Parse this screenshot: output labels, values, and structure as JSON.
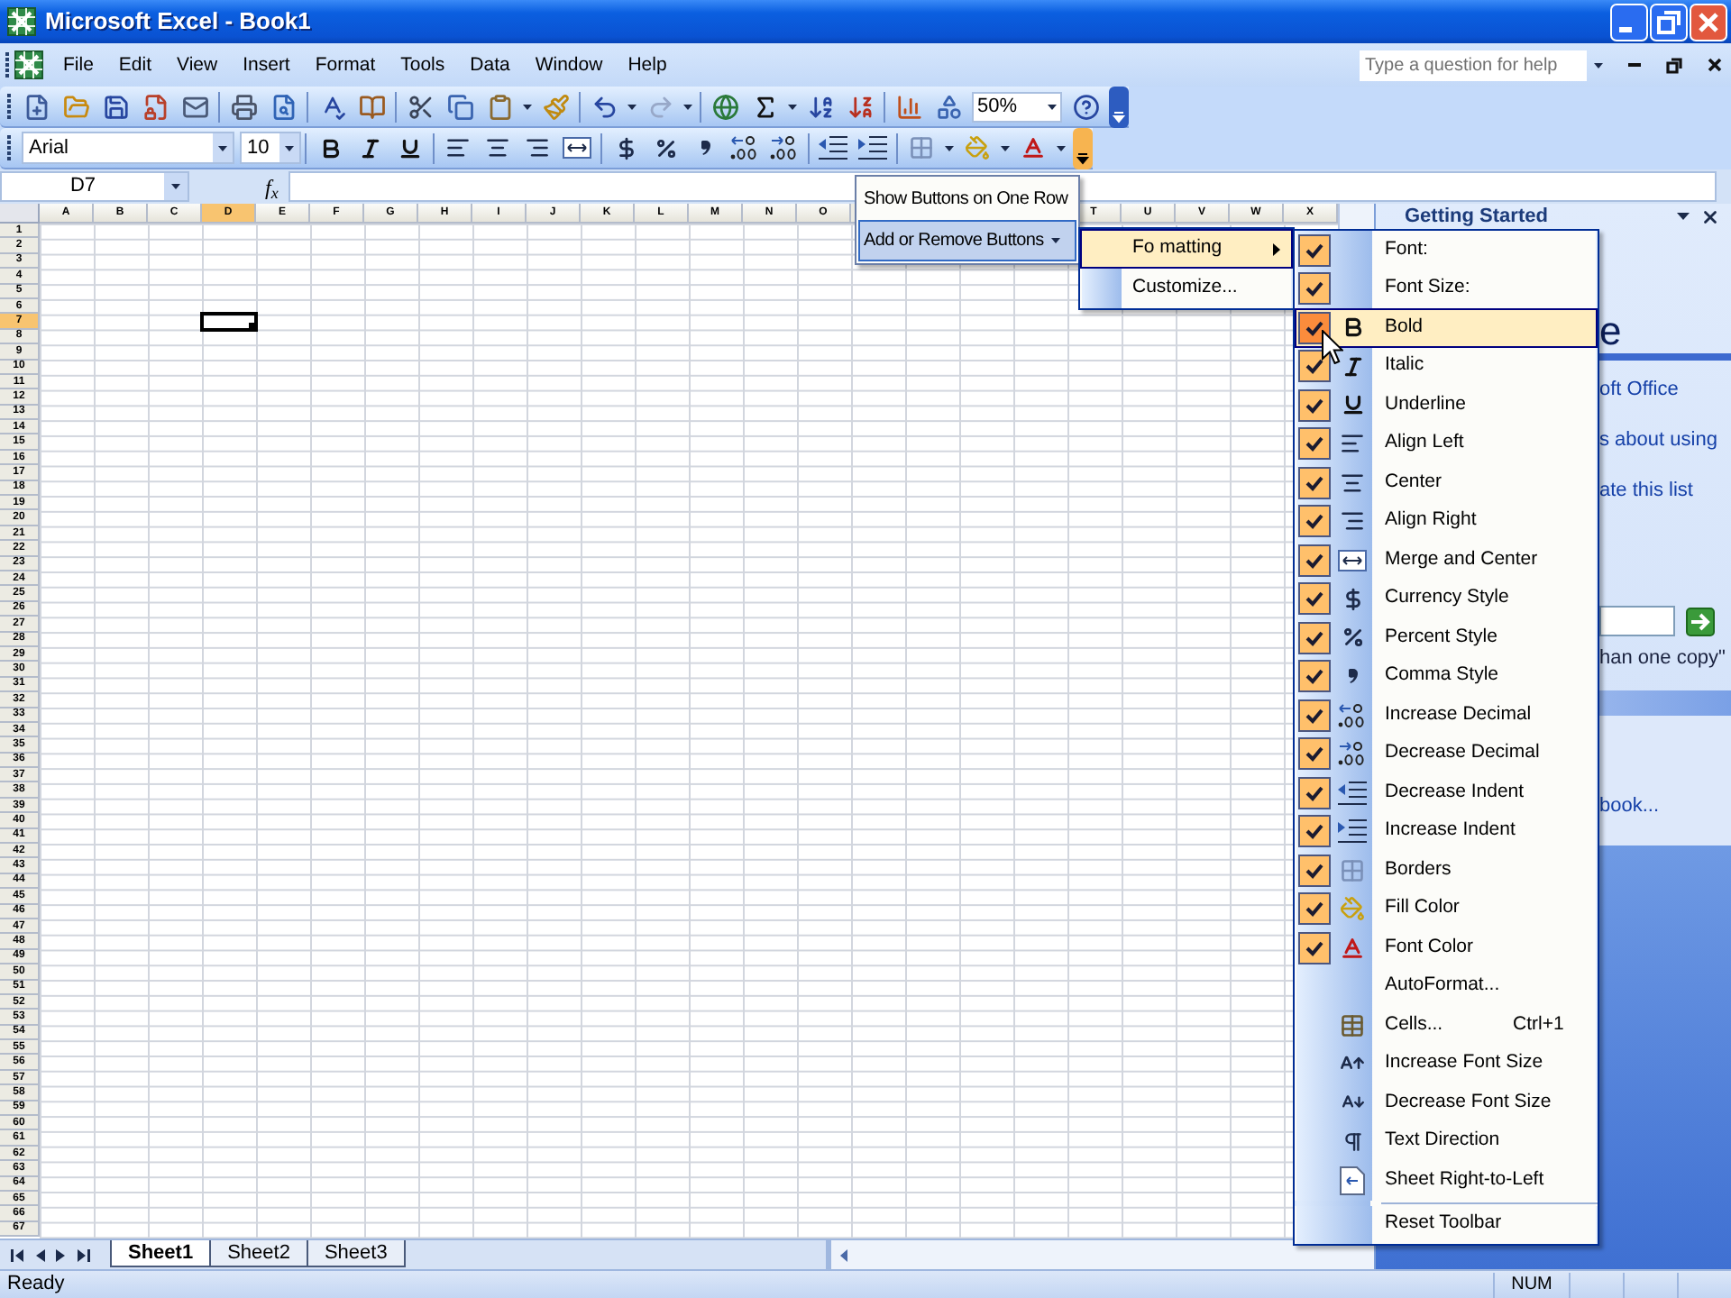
{
  "window": {
    "title": "Microsoft Excel - Book1"
  },
  "menu_bar": {
    "items": [
      "File",
      "Edit",
      "View",
      "Insert",
      "Format",
      "Tools",
      "Data",
      "Window",
      "Help"
    ],
    "help_box": {
      "placeholder": "Type a question for help"
    }
  },
  "standard_toolbar": {
    "zoom": "50%",
    "options_active": false
  },
  "formatting_toolbar": {
    "font": "Arial",
    "font_size": "10",
    "options_active": true
  },
  "formula_bar": {
    "name_box": "D7",
    "function_button": "f$_{x}$"
  },
  "grid": {
    "columns": [
      {
        "label": "A",
        "selected": false
      },
      {
        "label": "B",
        "selected": false
      },
      {
        "label": "C",
        "selected": false
      },
      {
        "label": "D",
        "selected": true
      },
      {
        "label": "E",
        "selected": false
      },
      {
        "label": "F",
        "selected": false
      },
      {
        "label": "G",
        "selected": false
      },
      {
        "label": "H",
        "selected": false
      },
      {
        "label": "I",
        "selected": false
      },
      {
        "label": "J",
        "selected": false
      },
      {
        "label": "K",
        "selected": false
      },
      {
        "label": "L",
        "selected": false
      },
      {
        "label": "M",
        "selected": false
      },
      {
        "label": "N",
        "selected": false
      },
      {
        "label": "O",
        "selected": false
      },
      {
        "label": "T",
        "selected": false
      },
      {
        "label": "U",
        "selected": false
      },
      {
        "label": "V",
        "selected": false
      },
      {
        "label": "W",
        "selected": false
      },
      {
        "label": "X",
        "selected": false
      }
    ],
    "rows": [
      {
        "label": "1",
        "selected": false
      },
      {
        "label": "2",
        "selected": false
      },
      {
        "label": "3",
        "selected": false
      },
      {
        "label": "4",
        "selected": false
      },
      {
        "label": "5",
        "selected": false
      },
      {
        "label": "6",
        "selected": false
      },
      {
        "label": "7",
        "selected": true
      },
      {
        "label": "8",
        "selected": false
      },
      {
        "label": "9",
        "selected": false
      },
      {
        "label": "10",
        "selected": false
      },
      {
        "label": "11",
        "selected": false
      },
      {
        "label": "12",
        "selected": false
      },
      {
        "label": "13",
        "selected": false
      },
      {
        "label": "14",
        "selected": false
      },
      {
        "label": "15",
        "selected": false
      },
      {
        "label": "16",
        "selected": false
      },
      {
        "label": "17",
        "selected": false
      },
      {
        "label": "18",
        "selected": false
      },
      {
        "label": "19",
        "selected": false
      },
      {
        "label": "20",
        "selected": false
      },
      {
        "label": "21",
        "selected": false
      },
      {
        "label": "22",
        "selected": false
      },
      {
        "label": "23",
        "selected": false
      },
      {
        "label": "24",
        "selected": false
      },
      {
        "label": "25",
        "selected": false
      },
      {
        "label": "26",
        "selected": false
      },
      {
        "label": "27",
        "selected": false
      },
      {
        "label": "28",
        "selected": false
      },
      {
        "label": "29",
        "selected": false
      },
      {
        "label": "30",
        "selected": false
      },
      {
        "label": "31",
        "selected": false
      },
      {
        "label": "32",
        "selected": false
      },
      {
        "label": "33",
        "selected": false
      },
      {
        "label": "34",
        "selected": false
      },
      {
        "label": "35",
        "selected": false
      },
      {
        "label": "36",
        "selected": false
      },
      {
        "label": "37",
        "selected": false
      },
      {
        "label": "38",
        "selected": false
      },
      {
        "label": "39",
        "selected": false
      },
      {
        "label": "40",
        "selected": false
      },
      {
        "label": "41",
        "selected": false
      },
      {
        "label": "42",
        "selected": false
      },
      {
        "label": "43",
        "selected": false
      },
      {
        "label": "44",
        "selected": false
      },
      {
        "label": "45",
        "selected": false
      },
      {
        "label": "46",
        "selected": false
      },
      {
        "label": "47",
        "selected": false
      },
      {
        "label": "48",
        "selected": false
      },
      {
        "label": "49",
        "selected": false
      },
      {
        "label": "50",
        "selected": false
      },
      {
        "label": "51",
        "selected": false
      },
      {
        "label": "52",
        "selected": false
      },
      {
        "label": "53",
        "selected": false
      },
      {
        "label": "54",
        "selected": false
      },
      {
        "label": "55",
        "selected": false
      },
      {
        "label": "56",
        "selected": false
      },
      {
        "label": "57",
        "selected": false
      },
      {
        "label": "58",
        "selected": false
      },
      {
        "label": "59",
        "selected": false
      },
      {
        "label": "60",
        "selected": false
      },
      {
        "label": "61",
        "selected": false
      },
      {
        "label": "62",
        "selected": false
      },
      {
        "label": "63",
        "selected": false
      },
      {
        "label": "64",
        "selected": false
      },
      {
        "label": "65",
        "selected": false
      },
      {
        "label": "66",
        "selected": false
      },
      {
        "label": "67",
        "selected": false
      }
    ]
  },
  "task_pane": {
    "title": "Getting Started",
    "heading": "e",
    "links": [
      "oft Office",
      "s about using",
      "ate this list"
    ],
    "example": "han one copy\"",
    "section_links": [
      "book..."
    ]
  },
  "toolbar_options_menu": {
    "items": [
      {
        "label": "Show Buttons on One Row",
        "selected": false,
        "submenu": false
      },
      {
        "label": "Add or Remove Buttons",
        "selected": true,
        "submenu": true
      }
    ]
  },
  "add_remove_menu": {
    "items": [
      {
        "label": "Fo matting",
        "selected": true,
        "submenu": true
      },
      {
        "label": "Customize...",
        "selected": false,
        "submenu": false
      }
    ]
  },
  "buttons_menu": {
    "items": [
      {
        "label": "Font:",
        "kind": "toggle",
        "checked": true,
        "selected": false
      },
      {
        "label": "Font Size:",
        "kind": "toggle",
        "checked": true,
        "selected": false
      },
      {
        "label": "Bold",
        "kind": "toggle",
        "checked": true,
        "selected": true
      },
      {
        "label": "Italic",
        "kind": "toggle",
        "checked": true,
        "selected": false
      },
      {
        "label": "Underline",
        "kind": "toggle",
        "checked": true,
        "selected": false
      },
      {
        "label": "Align Left",
        "kind": "toggle",
        "checked": true,
        "selected": false
      },
      {
        "label": "Center",
        "kind": "toggle",
        "checked": true,
        "selected": false
      },
      {
        "label": "Align Right",
        "kind": "toggle",
        "checked": true,
        "selected": false
      },
      {
        "label": "Merge and Center",
        "kind": "toggle",
        "checked": true,
        "selected": false
      },
      {
        "label": "Currency Style",
        "kind": "toggle",
        "checked": true,
        "selected": false
      },
      {
        "label": "Percent Style",
        "kind": "toggle",
        "checked": true,
        "selected": false
      },
      {
        "label": "Comma Style",
        "kind": "toggle",
        "checked": true,
        "selected": false
      },
      {
        "label": "Increase Decimal",
        "kind": "toggle",
        "checked": true,
        "selected": false
      },
      {
        "label": "Decrease Decimal",
        "kind": "toggle",
        "checked": true,
        "selected": false
      },
      {
        "label": "Decrease Indent",
        "kind": "toggle",
        "checked": true,
        "selected": false
      },
      {
        "label": "Increase Indent",
        "kind": "toggle",
        "checked": true,
        "selected": false
      },
      {
        "label": "Borders",
        "kind": "toggle",
        "checked": true,
        "selected": false
      },
      {
        "label": "Fill Color",
        "kind": "toggle",
        "checked": true,
        "selected": false
      },
      {
        "label": "Font Color",
        "kind": "toggle",
        "checked": true,
        "selected": false
      },
      {
        "label": "AutoFormat...",
        "kind": "toggle",
        "checked": false,
        "selected": false
      },
      {
        "label": "Cells...",
        "shortcut": "Ctrl+1",
        "kind": "toggle",
        "checked": false,
        "selected": false
      },
      {
        "label": "Increase Font Size",
        "kind": "toggle",
        "checked": false,
        "selected": false
      },
      {
        "label": "Decrease Font Size",
        "kind": "toggle",
        "checked": false,
        "selected": false
      },
      {
        "label": "Text Direction",
        "kind": "toggle",
        "checked": false,
        "selected": false
      },
      {
        "label": "Sheet Right-to-Left",
        "kind": "toggle",
        "checked": false,
        "selected": false
      },
      {
        "label": "Reset Toolbar",
        "kind": "command",
        "selected": false
      }
    ]
  },
  "sheet_tabs": [
    {
      "label": "Sheet1",
      "selected": true
    },
    {
      "label": "Sheet2",
      "selected": false
    },
    {
      "label": "Sheet3",
      "selected": false
    }
  ],
  "status_bar": {
    "status": "Ready",
    "indicators": [
      "NUM"
    ]
  }
}
